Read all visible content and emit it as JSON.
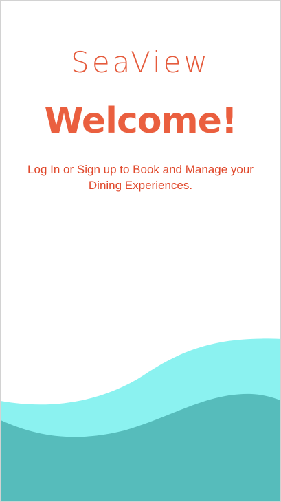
{
  "app": {
    "brand": "SeaView"
  },
  "welcome": {
    "title": "Welcome!",
    "subtitle": "Log In or Sign up to Book and Manage your Dining Experiences."
  },
  "colors": {
    "accent": "#ea5f3f",
    "wave_light": "#8bf2f0",
    "wave_dark": "#56bcbb"
  }
}
